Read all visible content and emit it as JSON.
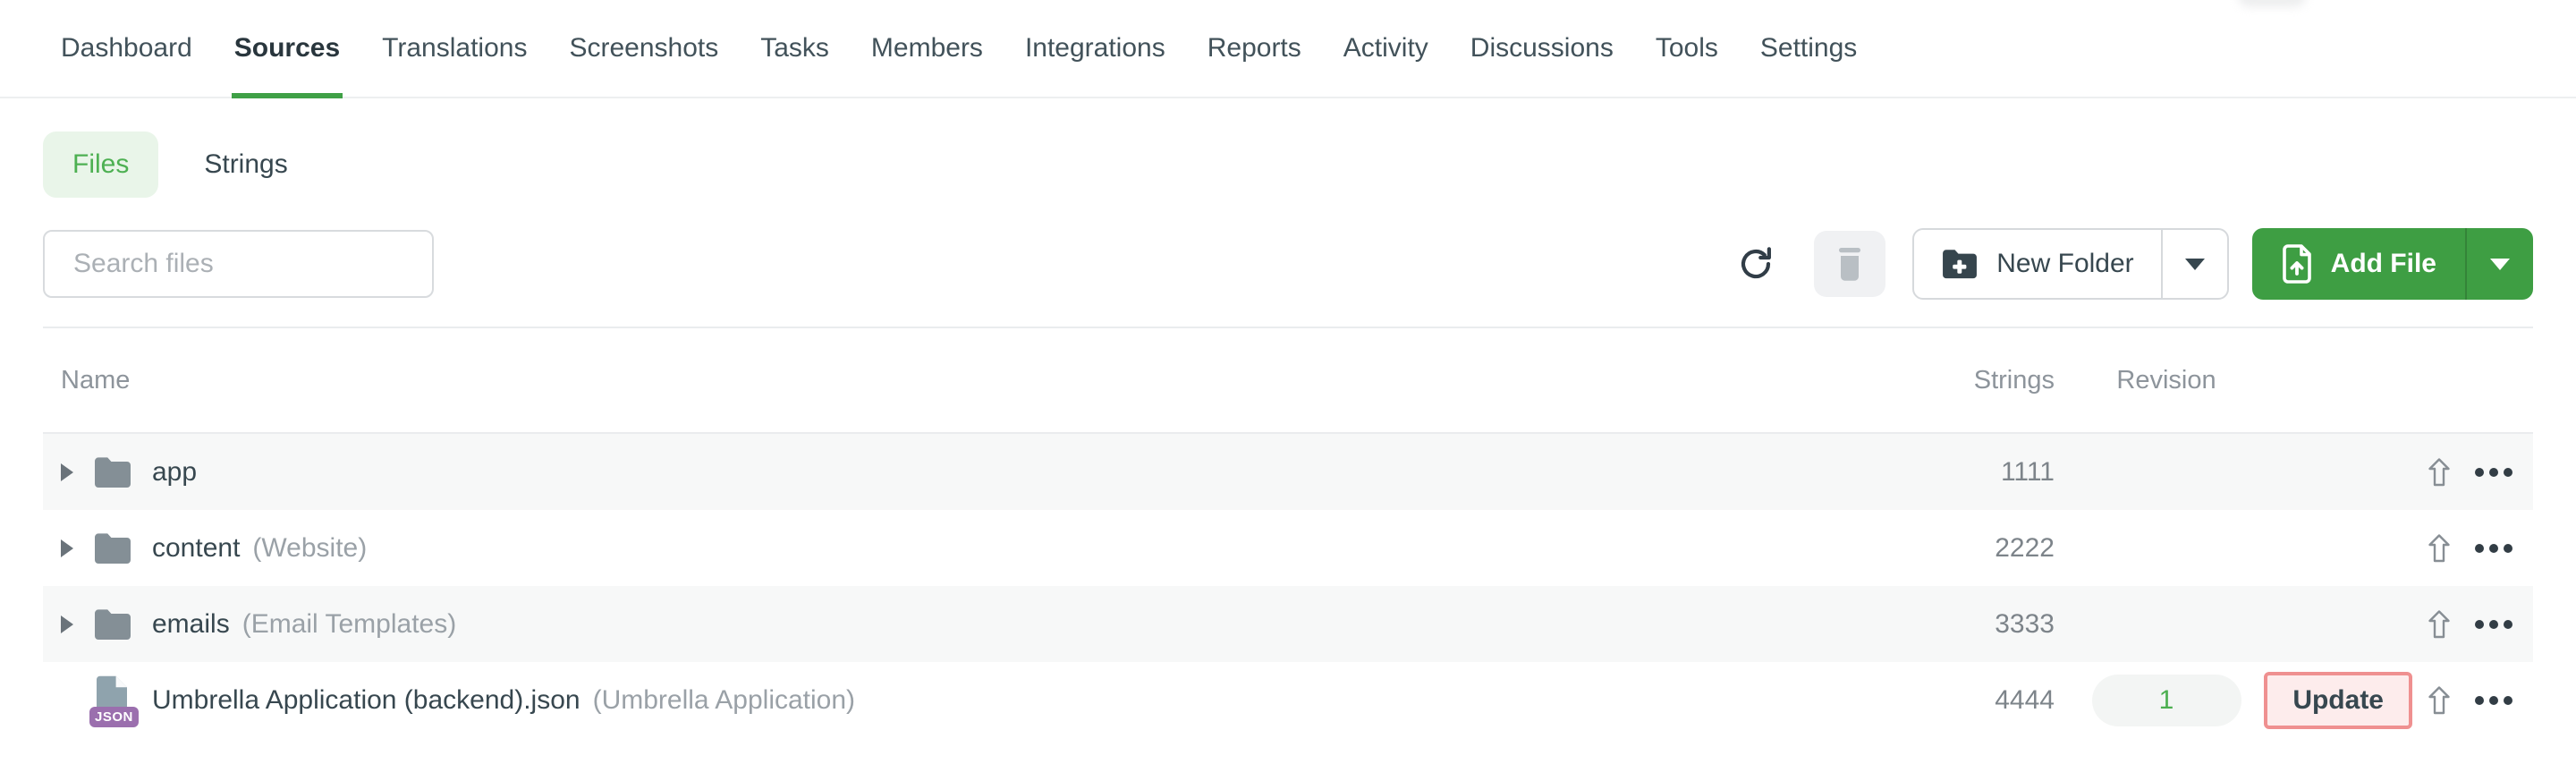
{
  "nav": {
    "items": [
      {
        "label": "Dashboard",
        "active": false
      },
      {
        "label": "Sources",
        "active": true
      },
      {
        "label": "Translations",
        "active": false
      },
      {
        "label": "Screenshots",
        "active": false
      },
      {
        "label": "Tasks",
        "active": false
      },
      {
        "label": "Members",
        "active": false
      },
      {
        "label": "Integrations",
        "active": false
      },
      {
        "label": "Reports",
        "active": false
      },
      {
        "label": "Activity",
        "active": false
      },
      {
        "label": "Discussions",
        "active": false
      },
      {
        "label": "Tools",
        "active": false
      },
      {
        "label": "Settings",
        "active": false
      }
    ]
  },
  "tabs": {
    "files_label": "Files",
    "strings_label": "Strings",
    "active": "Files"
  },
  "search": {
    "placeholder": "Search files",
    "value": ""
  },
  "toolbar": {
    "refresh_icon": "refresh-icon",
    "trash_icon": "trash-icon",
    "new_folder_label": "New Folder",
    "add_file_label": "Add File"
  },
  "table": {
    "columns": {
      "name": "Name",
      "strings": "Strings",
      "revision": "Revision"
    },
    "rows": [
      {
        "type": "folder",
        "name": "app",
        "subtitle": "",
        "strings": "1111",
        "revision": "",
        "update_label": ""
      },
      {
        "type": "folder",
        "name": "content",
        "subtitle": "(Website)",
        "strings": "2222",
        "revision": "",
        "update_label": ""
      },
      {
        "type": "folder",
        "name": "emails",
        "subtitle": "(Email Templates)",
        "strings": "3333",
        "revision": "",
        "update_label": ""
      },
      {
        "type": "file-json",
        "badge": "JSON",
        "name": "Umbrella Application (backend).json",
        "subtitle": "(Umbrella Application)",
        "strings": "4444",
        "revision": "1",
        "update_label": "Update"
      }
    ]
  },
  "colors": {
    "accent_green": "#3e9e43",
    "tab_green_text": "#4db052",
    "tab_green_bg": "#e9f5e9",
    "nav_underline": "#3fa046",
    "update_border": "#ef9090",
    "update_bg": "#fdecec",
    "revision_text": "#4caf50",
    "json_badge": "#9b6fae",
    "row_shade": "#f7f8f8",
    "text_dark": "#37474f",
    "text_muted": "#9aa1a7"
  }
}
